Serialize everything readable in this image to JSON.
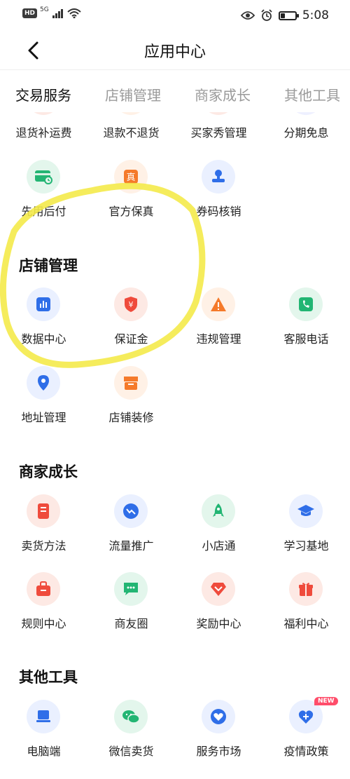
{
  "status_bar": {
    "hd": "HD",
    "network": "5G",
    "time": "5:08",
    "battery_level": 0.3
  },
  "nav": {
    "title": "应用中心"
  },
  "tabs": [
    {
      "label": "交易服务",
      "active": true
    },
    {
      "label": "店铺管理",
      "active": false
    },
    {
      "label": "商家成长",
      "active": false
    },
    {
      "label": "其他工具",
      "active": false
    }
  ],
  "trade": {
    "row1": [
      "退货补运费",
      "退款不退货",
      "买家秀管理",
      "分期免息"
    ],
    "row2": [
      "先用后付",
      "官方保真",
      "券码核销"
    ]
  },
  "store": {
    "title": "店铺管理",
    "items": [
      "数据中心",
      "保证金",
      "违规管理",
      "客服电话",
      "地址管理",
      "店铺装修"
    ]
  },
  "growth": {
    "title": "商家成长",
    "items": [
      "卖货方法",
      "流量推广",
      "小店通",
      "学习基地",
      "规则中心",
      "商友圈",
      "奖励中心",
      "福利中心"
    ]
  },
  "tools": {
    "title": "其他工具",
    "items": [
      "电脑端",
      "微信卖货",
      "服务市场",
      "疫情政策"
    ],
    "new_badge": "NEW"
  },
  "colors": {
    "accent_yellow": "#f4ea4a",
    "tab_inactive": "#9a9a9a",
    "blue": "#2f6ee8",
    "red": "#ef4b3c",
    "orange": "#f57a2a",
    "green": "#22b573"
  }
}
